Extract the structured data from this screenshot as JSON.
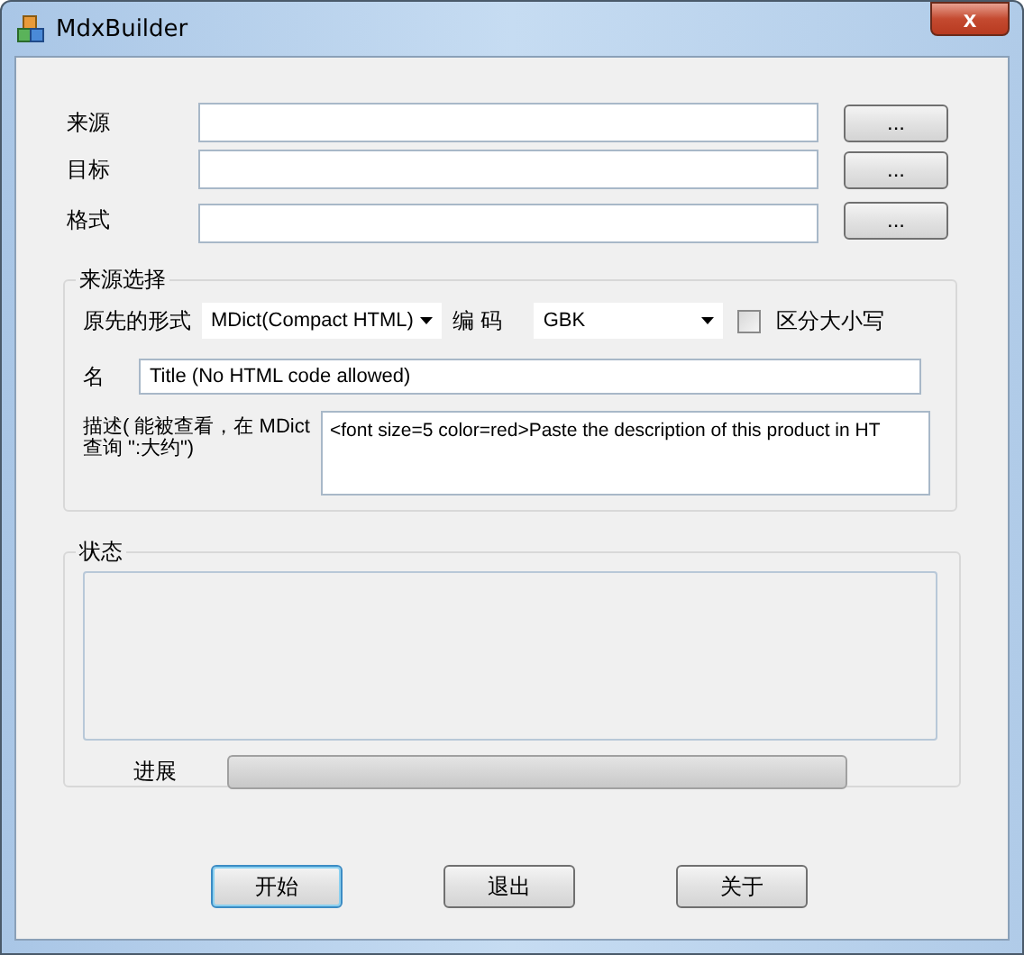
{
  "window": {
    "title": "MdxBuilder",
    "close": "x"
  },
  "paths": [
    {
      "label": "来源",
      "button": "..."
    },
    {
      "label": "目标",
      "button": "..."
    },
    {
      "label": "格式",
      "button": "..."
    }
  ],
  "source": {
    "title": "来源选择",
    "format_label": "原先的形式",
    "format": "MDict(Compact HTML)",
    "encoding_label": "编 码",
    "encoding": "GBK",
    "case": {
      "label": "区分大小写",
      "checked": false
    },
    "name_label": "名",
    "name": "Title (No HTML code allowed)",
    "desc_label": "描述( 能被查看，在 MDict查询 \":大约\")",
    "desc": "<font size=5 color=red>Paste the description of this product in HT"
  },
  "status": {
    "title": "状态",
    "progress_label": "进展",
    "level": 0
  },
  "buttons": [
    {
      "label": "开始",
      "default": true
    },
    {
      "label": "退出",
      "default": false
    },
    {
      "label": "关于",
      "default": false
    }
  ]
}
